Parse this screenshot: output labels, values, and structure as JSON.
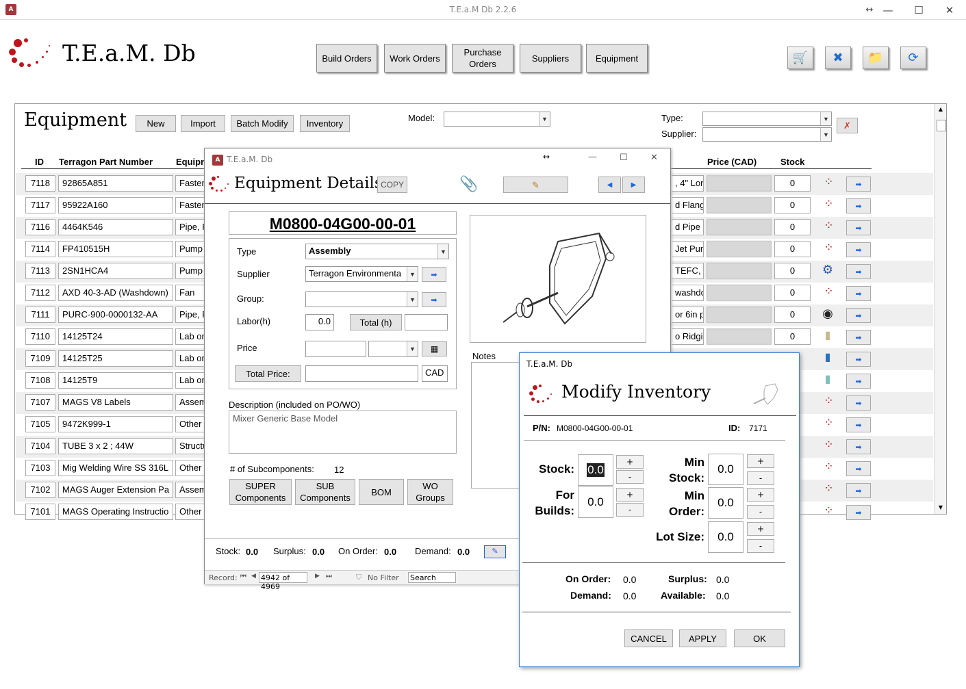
{
  "window": {
    "title": "T.E.a.M Db 2.2.6",
    "app_icon": "A"
  },
  "header": {
    "app_name": "T.E.a.M. Db",
    "nav": [
      "Build Orders",
      "Work Orders",
      "Purchase Orders",
      "Suppliers",
      "Equipment"
    ],
    "icons": [
      "cart-icon",
      "tools-icon",
      "folder-icon",
      "refresh-icon"
    ]
  },
  "equipment": {
    "title": "Equipment",
    "buttons": {
      "new": "New",
      "import": "Import",
      "batch": "Batch Modify",
      "inventory": "Inventory"
    },
    "filters": {
      "model_label": "Model:",
      "type_label": "Type:",
      "supplier_label": "Supplier:"
    },
    "columns": {
      "id": "ID",
      "part": "Terragon Part Number",
      "equip": "Equipm",
      "price": "Price (CAD)",
      "stock": "Stock"
    },
    "rows": [
      {
        "id": "7118",
        "part": "92865A851",
        "type": "Fasten",
        "desc": ", 4\" Lon",
        "stock": "0",
        "thumb": "logo"
      },
      {
        "id": "7117",
        "part": "95922A160",
        "type": "Fasten",
        "desc": "d Flang",
        "stock": "0",
        "thumb": "logo"
      },
      {
        "id": "7116",
        "part": "4464K546",
        "type": "Pipe, F",
        "desc": "d Pipe F",
        "stock": "0",
        "thumb": "logo"
      },
      {
        "id": "7114",
        "part": "FP410515H",
        "type": "Pump",
        "desc": "Jet Pun",
        "stock": "0",
        "thumb": "logo"
      },
      {
        "id": "7113",
        "part": "2SN1HCA4",
        "type": "Pump",
        "desc": "TEFC, 3",
        "stock": "0",
        "thumb": "pump"
      },
      {
        "id": "7112",
        "part": "AXD 40-3-AD (Washdown)",
        "type": "Fan",
        "desc": "washdo",
        "stock": "0",
        "thumb": "logo"
      },
      {
        "id": "7111",
        "part": "PURC-900-0000132-AA",
        "type": "Pipe, F",
        "desc": "or 6in p",
        "stock": "0",
        "thumb": "coil"
      },
      {
        "id": "7110",
        "part": "14125T24",
        "type": "Lab or",
        "desc": "o Ridgi",
        "stock": "0",
        "thumb": "spool"
      },
      {
        "id": "7109",
        "part": "14125T25",
        "type": "Lab or",
        "desc": "",
        "stock": "",
        "thumb": "bluespool"
      },
      {
        "id": "7108",
        "part": "14125T9",
        "type": "Lab or",
        "desc": "",
        "stock": "",
        "thumb": "tealspool"
      },
      {
        "id": "7107",
        "part": "MAGS V8 Labels",
        "type": "Assem",
        "desc": "",
        "stock": "",
        "thumb": "logo"
      },
      {
        "id": "7105",
        "part": "9472K999-1",
        "type": "Other",
        "desc": "",
        "stock": "",
        "thumb": "logo"
      },
      {
        "id": "7104",
        "part": "TUBE 3 x 2 ; 44W",
        "type": "Structu",
        "desc": "",
        "stock": "",
        "thumb": "logo"
      },
      {
        "id": "7103",
        "part": "Mig Welding Wire SS 316L",
        "type": "Other",
        "desc": "",
        "stock": "",
        "thumb": "logo"
      },
      {
        "id": "7102",
        "part": "MAGS Auger Extension Pa",
        "type": "Assem",
        "desc": "",
        "stock": "",
        "thumb": "logo"
      },
      {
        "id": "7101",
        "part": "MAGS Operating Instructio",
        "type": "Other",
        "desc": "",
        "stock": "",
        "thumb": "logo"
      }
    ]
  },
  "details": {
    "window_title": "T.E.a.M. Db",
    "title": "Equipment Details",
    "copy": "COPY",
    "part_number": "M0800-04G00-00-01",
    "type_label": "Type",
    "type_value": "Assembly",
    "supplier_label": "Supplier",
    "supplier_value": "Terragon Environmenta",
    "group_label": "Group:",
    "labor_label": "Labor(h)",
    "labor_value": "0.0",
    "total_h": "Total (h)",
    "price_label": "Price",
    "total_price": "Total Price:",
    "currency": "CAD",
    "desc_label": "Description (included on PO/WO)",
    "desc_value": "Mixer Generic Base Model",
    "notes_label": "Notes",
    "subcomp_label": "# of Subcomponents:",
    "subcomp_value": "12",
    "buttons": {
      "super": "SUPER Components",
      "sub": "SUB Components",
      "bom": "BOM",
      "wo": "WO Groups"
    },
    "footer": {
      "stock_l": "Stock:",
      "stock_v": "0.0",
      "surplus_l": "Surplus:",
      "surplus_v": "0.0",
      "onorder_l": "On Order:",
      "onorder_v": "0.0",
      "demand_l": "Demand:",
      "demand_v": "0.0"
    },
    "record": {
      "label": "Record:",
      "value": "4942 of 4969",
      "filter": "No Filter",
      "search": "Search"
    }
  },
  "modify": {
    "window_title": "T.E.a.M. Db",
    "title": "Modify Inventory",
    "pn_label": "P/N:",
    "pn_value": "M0800-04G00-00-01",
    "id_label": "ID:",
    "id_value": "7171",
    "stock_label": "Stock:",
    "stock_value": "0.0",
    "builds_label": "For Builds:",
    "builds_value": "0.0",
    "minstock_label": "Min Stock:",
    "minstock_value": "0.0",
    "minorder_label": "Min Order:",
    "minorder_value": "0.0",
    "lotsize_label": "Lot Size:",
    "lotsize_value": "0.0",
    "onorder_label": "On Order:",
    "onorder_value": "0.0",
    "surplus_label": "Surplus:",
    "surplus_value": "0.0",
    "demand_label": "Demand:",
    "demand_value": "0.0",
    "available_label": "Available:",
    "available_value": "0.0",
    "cancel": "CANCEL",
    "apply": "APPLY",
    "ok": "OK",
    "plus": "+",
    "minus": "-"
  }
}
